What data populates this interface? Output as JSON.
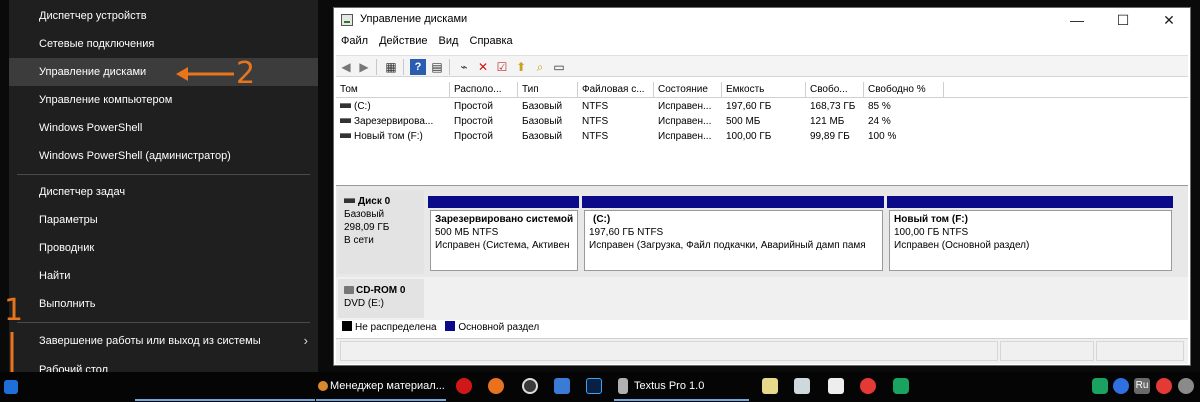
{
  "context_menu": {
    "items": [
      "Диспетчер устройств",
      "Сетевые подключения",
      "Управление дисками",
      "Управление компьютером",
      "Windows PowerShell",
      "Windows PowerShell (администратор)",
      "Диспетчер задач",
      "Параметры",
      "Проводник",
      "Найти",
      "Выполнить",
      "Завершение работы или выход из системы",
      "Рабочий стол"
    ],
    "highlighted_index": 2,
    "submenu_arrow": "›"
  },
  "annotations": {
    "arrow_to_menu_item_number": "2",
    "arrow_to_start_number": "1",
    "color": "#e8741c"
  },
  "window": {
    "title": "Управление дисками",
    "controls": {
      "minimize": "—",
      "maximize": "☐",
      "close": "✕"
    },
    "menu": [
      "Файл",
      "Действие",
      "Вид",
      "Справка"
    ]
  },
  "volume_list": {
    "columns": [
      "Том",
      "Располо...",
      "Тип",
      "Файловая с...",
      "Состояние",
      "Емкость",
      "Свобо...",
      "Свободно %"
    ],
    "rows": [
      [
        "(C:)",
        "Простой",
        "Базовый",
        "NTFS",
        "Исправен...",
        "197,60 ГБ",
        "168,73 ГБ",
        "85 %"
      ],
      [
        "Зарезервирова...",
        "Простой",
        "Базовый",
        "NTFS",
        "Исправен...",
        "500 МБ",
        "121 МБ",
        "24 %"
      ],
      [
        "Новый том (F:)",
        "Простой",
        "Базовый",
        "NTFS",
        "Исправен...",
        "100,00 ГБ",
        "99,89 ГБ",
        "100 %"
      ]
    ]
  },
  "disks": [
    {
      "name": "Диск 0",
      "type": "Базовый",
      "size": "298,09 ГБ",
      "status": "В сети",
      "partitions": [
        {
          "title": "Зарезервировано системой",
          "size": "500 МБ NTFS",
          "state": "Исправен (Система, Активен"
        },
        {
          "title": "(C:)",
          "size": "197,60 ГБ NTFS",
          "state": "Исправен (Загрузка, Файл подкачки, Аварийный дамп памя"
        },
        {
          "title": "Новый том  (F:)",
          "size": "100,00 ГБ NTFS",
          "state": "Исправен (Основной раздел)"
        }
      ]
    },
    {
      "name": "CD-ROM 0",
      "type": "DVD (E:)"
    }
  ],
  "legend": {
    "unallocated": "Не распределена",
    "primary": "Основной раздел",
    "unallocated_color": "#000000",
    "primary_color": "#0b0b8a"
  },
  "taskbar": {
    "items": [
      "Менеджер материал...",
      "Textus Pro 1.0"
    ]
  }
}
